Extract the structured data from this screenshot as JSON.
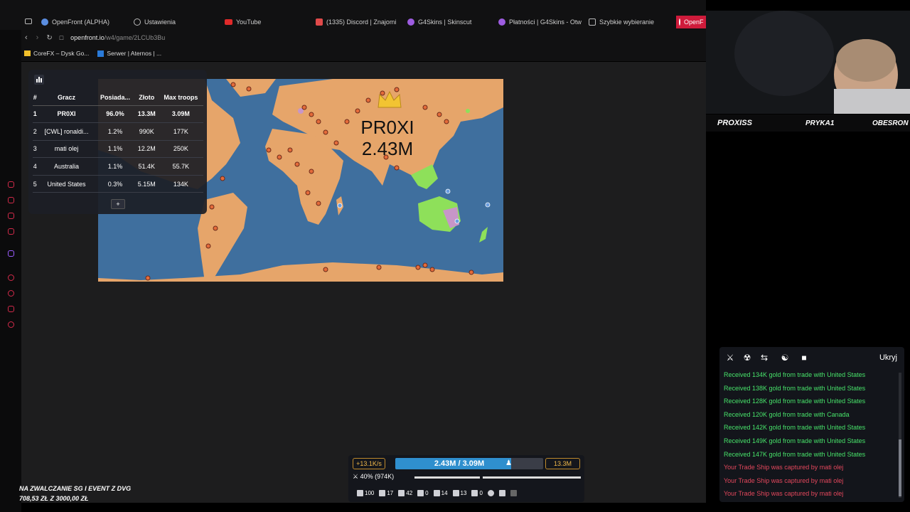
{
  "browser": {
    "tabs": [
      {
        "label": "OpenFront (ALPHA)",
        "icon": "openfront-icon",
        "color": "#5a8de0"
      },
      {
        "label": "Ustawienia",
        "icon": "gear-icon",
        "color": "#bbbbbb"
      },
      {
        "label": "YouTube",
        "icon": "youtube-icon",
        "color": "#e02a2a"
      },
      {
        "label": "(1335) Discord | Znajomi",
        "icon": "discord-icon",
        "color": "#e04a4a"
      },
      {
        "label": "G4Skins | Skinscut",
        "icon": "g4skins-icon",
        "color": "#9d5ce0"
      },
      {
        "label": "Płatności | G4Skins - Otw",
        "icon": "g4skins-icon",
        "color": "#9d5ce0"
      },
      {
        "label": "Szybkie wybieranie",
        "icon": "grid-icon",
        "color": "#bbbbbb"
      },
      {
        "label": "OpenF",
        "icon": "openfront-icon",
        "color": "#ffffff"
      }
    ],
    "url_host": "openfront.io",
    "url_path": "/w4/game/2LCUb3Bu",
    "bookmarks": [
      "CoreFX – Dysk Go...",
      "Serwer | Aternos | ..."
    ]
  },
  "leaderboard": {
    "headers": [
      "#",
      "Gracz",
      "Posiada...",
      "Złoto",
      "Max troops"
    ],
    "rows": [
      [
        "1",
        "PR0XI",
        "96.0%",
        "13.3M",
        "3.09M"
      ],
      [
        "2",
        "[CWL] ronaldi...",
        "1.2%",
        "990K",
        "177K"
      ],
      [
        "3",
        "mati olej",
        "1.1%",
        "12.2M",
        "250K"
      ],
      [
        "4",
        "Australia",
        "1.1%",
        "51.4K",
        "55.7K"
      ],
      [
        "5",
        "United States",
        "0.3%",
        "5.15M",
        "134K"
      ]
    ],
    "more_label": "+"
  },
  "map_label": {
    "name": "PR0XI",
    "troops": "2.43M"
  },
  "events": {
    "hide_label": "Ukryj",
    "lines": [
      {
        "text": "Received 134K gold from trade with United States",
        "type": "green"
      },
      {
        "text": "Received 138K gold from trade with United States",
        "type": "green"
      },
      {
        "text": "Received 128K gold from trade with United States",
        "type": "green"
      },
      {
        "text": "Received 120K gold from trade with Canada",
        "type": "green"
      },
      {
        "text": "Received 142K gold from trade with United States",
        "type": "green"
      },
      {
        "text": "Received 149K gold from trade with United States",
        "type": "green"
      },
      {
        "text": "Received 147K gold from trade with United States",
        "type": "green"
      },
      {
        "text": "Your Trade Ship was captured by mati olej",
        "type": "red"
      },
      {
        "text": "Your Trade Ship was captured by mati olej",
        "type": "red"
      },
      {
        "text": "Your Trade Ship was captured by mati olej",
        "type": "red"
      }
    ]
  },
  "control": {
    "income": "+13.1K/s",
    "troops_text": "2.43M / 3.09M",
    "troops_fraction": 0.786,
    "gold": "13.3M",
    "attack_ratio": "40% (974K)",
    "buildings": [
      {
        "key": "1",
        "count": "100"
      },
      {
        "key": "2",
        "count": "17"
      },
      {
        "key": "3",
        "count": "42"
      },
      {
        "key": "4",
        "count": "0"
      },
      {
        "key": "5",
        "count": "14"
      },
      {
        "key": "6",
        "count": "13"
      },
      {
        "key": "7",
        "count": "0"
      },
      {
        "key": "8",
        "count": ""
      },
      {
        "key": "9",
        "count": ""
      },
      {
        "key": "0",
        "count": ""
      }
    ]
  },
  "stream": {
    "streamer_name": "PROXISS",
    "follower_1": "PRYKA1",
    "follower_2": "OBESRON",
    "promo_line1": "NA ZWALCZANIE SG I EVENT Z DVG",
    "promo_line2": "708,53 ZŁ Z 3000,00 ZŁ"
  }
}
